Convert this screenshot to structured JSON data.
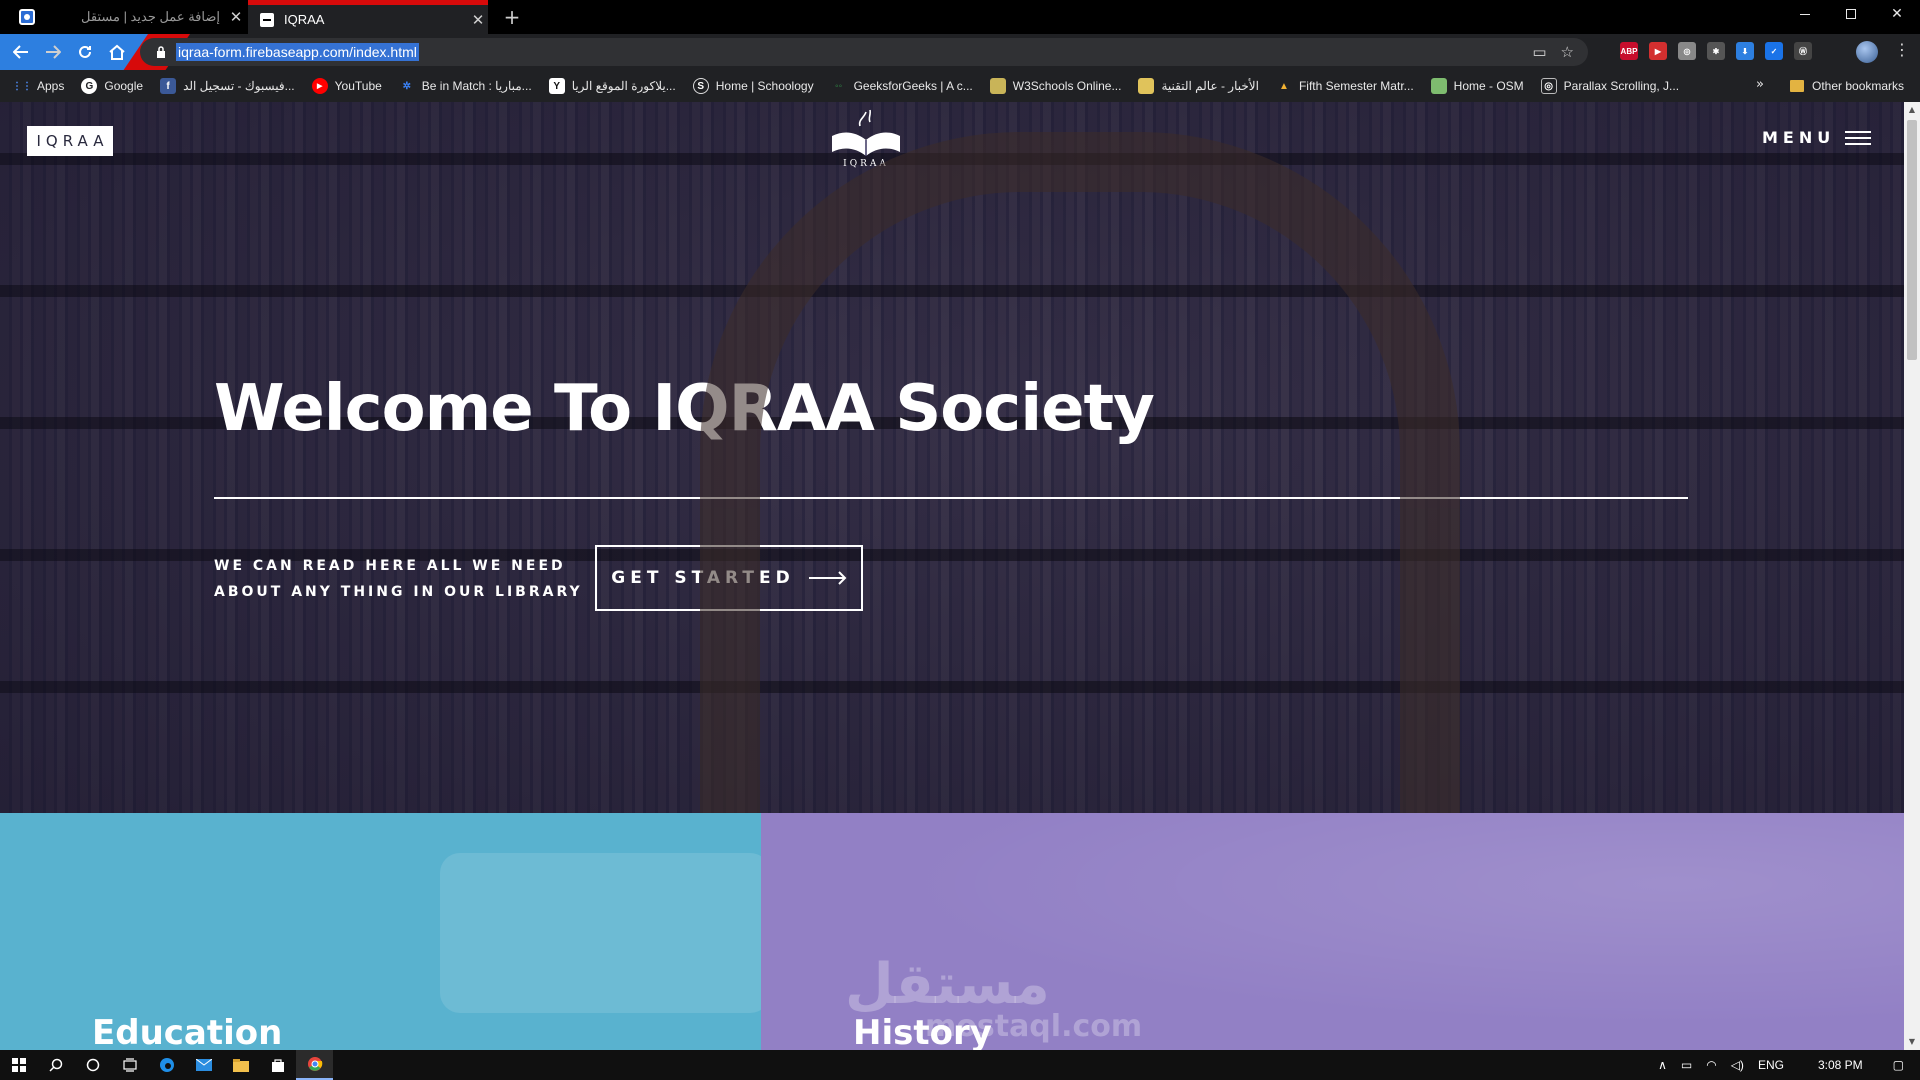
{
  "browser": {
    "tabs": [
      {
        "title": "إضافة عمل جديد | مستقل",
        "active": false
      },
      {
        "title": "IQRAA",
        "active": true
      }
    ],
    "url": "iqraa-form.firebaseapp.com/index.html",
    "bookmarks": [
      {
        "label": "Apps",
        "icon": "apps-grid-icon",
        "color": "#4f8ef7"
      },
      {
        "label": "Google",
        "icon": "google-icon",
        "color": "#ffffff"
      },
      {
        "label": "فيسبوك - تسجيل الد...",
        "icon": "facebook-icon",
        "color": "#3b5998"
      },
      {
        "label": "YouTube",
        "icon": "youtube-icon",
        "color": "#ff0000"
      },
      {
        "label": "Be in Match : مباريا...",
        "icon": "gear-icon",
        "color": "#3b82f6"
      },
      {
        "label": "يلاكورة الموقع الريا...",
        "icon": "y-icon",
        "color": "#111111"
      },
      {
        "label": "Home | Schoology",
        "icon": "schoology-icon",
        "color": "#2a2a2a"
      },
      {
        "label": "GeeksforGeeks | A c...",
        "icon": "geeks-icon",
        "color": "#2f8d46"
      },
      {
        "label": "W3Schools Online...",
        "icon": "w3-icon",
        "color": "#c9b458"
      },
      {
        "label": "الأخبار - عالم التقنية",
        "icon": "news-icon",
        "color": "#e0c35b"
      },
      {
        "label": "Fifth Semester Matr...",
        "icon": "drive-icon",
        "color": "#f2b233"
      },
      {
        "label": "Home - OSM",
        "icon": "osm-icon",
        "color": "#7ebc6f"
      },
      {
        "label": "Parallax Scrolling, J...",
        "icon": "parallax-icon",
        "color": "#bbbbbb"
      }
    ],
    "bookmarks_more": "»",
    "other_bookmarks": "Other bookmarks",
    "extensions": [
      {
        "label": "ABP",
        "color": "#c70d2c"
      },
      {
        "label": "▶",
        "color": "#d32f2f"
      },
      {
        "label": "◎",
        "color": "#888888"
      },
      {
        "label": "✱",
        "color": "#555555"
      },
      {
        "label": "⬇",
        "color": "#2d7fe0"
      },
      {
        "label": "✓",
        "color": "#1a73e8"
      },
      {
        "label": "Ⓦ",
        "color": "#444444"
      }
    ]
  },
  "site": {
    "brand": "IQRAA",
    "logo_text": "IQRAA",
    "menu_label": "MENU",
    "hero": {
      "title": "Welcome To IQRAA Society",
      "subtitle": "WE CAN READ HERE ALL WE NEED ABOUT ANY THING IN OUR LIBRARY",
      "cta_label": "GET STARTED"
    },
    "panels": [
      {
        "title": "Education",
        "color": "#59b2cf"
      },
      {
        "title": "History",
        "color": "#9280c5"
      }
    ],
    "watermark": {
      "arabic": "مستقل",
      "latin": "mostaql.com"
    }
  },
  "taskbar": {
    "language": "ENG",
    "time": "3:08 PM"
  }
}
